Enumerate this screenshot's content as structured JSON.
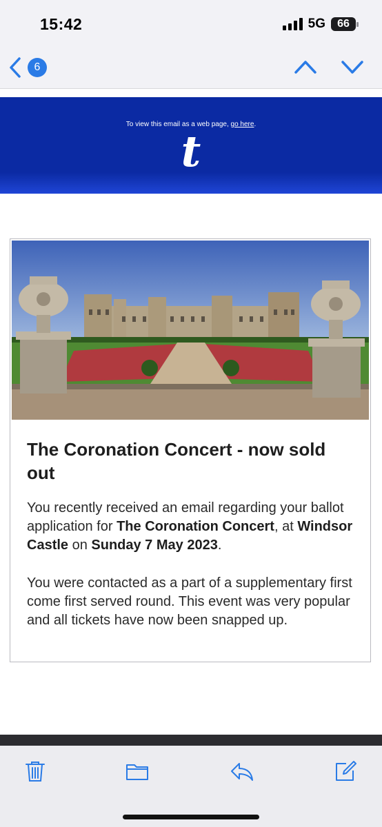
{
  "status_bar": {
    "time": "15:42",
    "network": "5G",
    "battery": "66"
  },
  "nav": {
    "back_count": "6"
  },
  "email": {
    "header": {
      "webpage_prefix": "To view this email as a web page, ",
      "webpage_link": "go here",
      "webpage_suffix": ".",
      "logo": "t"
    },
    "card": {
      "title": "The Coronation Concert - now sold out",
      "p1_a": "You recently received an email regarding your ballot application for ",
      "p1_event": "The Coronation Concert",
      "p1_b": ", at ",
      "p1_venue": "Windsor Castle",
      "p1_c": " on ",
      "p1_date": "Sunday 7 May 2023",
      "p1_d": ".",
      "p2": "You were contacted as a part of a supplementary first come first served round. This event was very popular and all tickets have now been snapped up."
    }
  },
  "colors": {
    "accent": "#2a7be6",
    "header_blue": "#0b2aa3",
    "toolbar": "#ececf0"
  },
  "toolbar": {
    "icons": [
      "trash-icon",
      "folder-icon",
      "reply-icon",
      "compose-icon"
    ]
  }
}
